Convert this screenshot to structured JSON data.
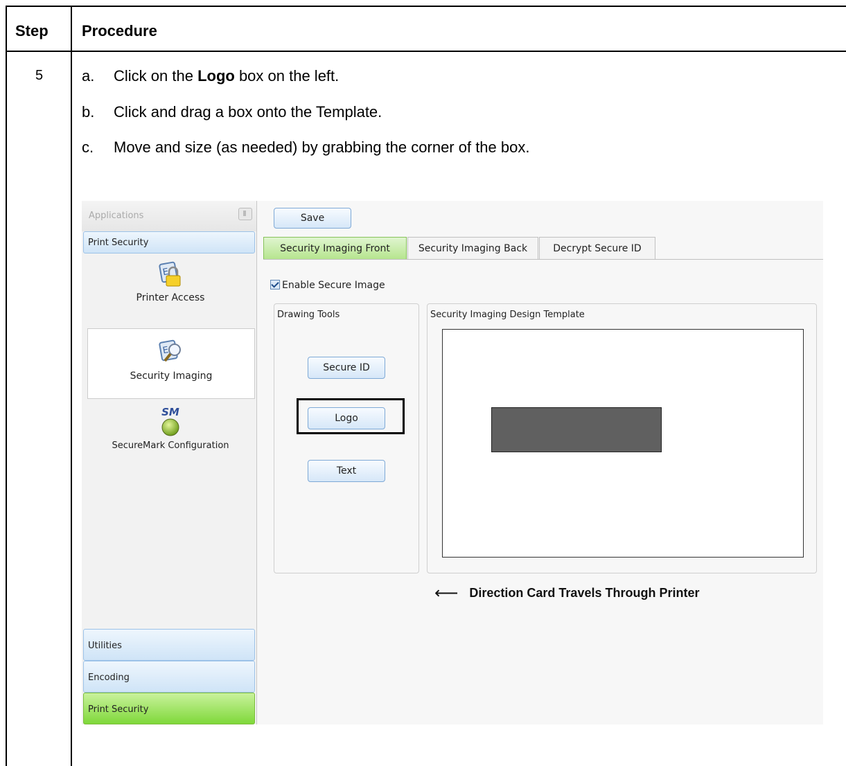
{
  "table": {
    "header_step": "Step",
    "header_procedure": "Procedure",
    "step_number": "5",
    "lines": [
      {
        "letter": "a.",
        "before": "Click on the ",
        "bold": "Logo",
        "after": " box on the left."
      },
      {
        "letter": "b.",
        "before": "Click and drag a box onto the Template.",
        "bold": "",
        "after": ""
      },
      {
        "letter": "c.",
        "before": "Move and size (as needed) by grabbing the corner of the box.",
        "bold": "",
        "after": ""
      }
    ]
  },
  "screenshot": {
    "left_panel": {
      "title": "Applications",
      "section": "Print Security",
      "items": [
        {
          "label": "Printer Access",
          "icon": "lock-key-icon"
        },
        {
          "label": "Security Imaging",
          "icon": "magnifier-key-icon"
        },
        {
          "label": "SecureMark Configuration",
          "icon": "securemark-icon",
          "icon_text": "SM"
        }
      ],
      "bottom_sections": [
        "Utilities",
        "Encoding",
        "Print Security"
      ]
    },
    "main": {
      "save_label": "Save",
      "tabs": [
        "Security Imaging Front",
        "Security Imaging Back",
        "Decrypt Secure ID"
      ],
      "active_tab": 0,
      "checkbox_label": "Enable Secure Image",
      "checkbox_checked": true,
      "drawing_tools_title": "Drawing Tools",
      "tools": [
        "Secure ID",
        "Logo",
        "Text"
      ],
      "template_title": "Security Imaging Design Template",
      "direction_label": "Direction Card Travels Through Printer",
      "colors": {
        "accent_blue": "#7ea9d6",
        "active_tab_green": "#b6e58e",
        "logo_box": "#606060"
      }
    }
  }
}
